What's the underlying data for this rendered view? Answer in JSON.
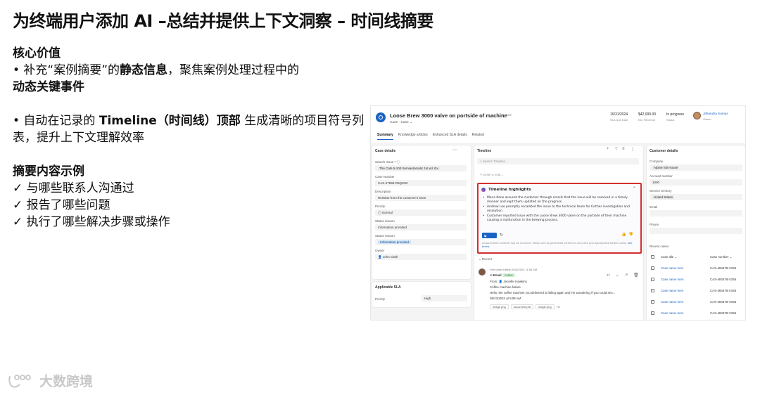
{
  "slide": {
    "title": "为终端用户添加 AI –总结并提供上下文洞察 – 时间线摘要",
    "value_heading": "核心价值",
    "value_line1_pre": "• 补充“案例摘要”的",
    "value_line1_bold": "静态信息",
    "value_line1_post": "，聚焦案例处理过程中的",
    "value_line2_bold": "动态关键事件",
    "auto_pre": "• 自动在记录的 ",
    "auto_bold": "Timeline（时间线）顶部",
    "auto_post": " 生成清晰的项目符号列表，提升上下文理解效率",
    "example_heading": "摘要内容示例",
    "examples": [
      "✓ 与哪些联系人沟通过",
      "✓ 报告了哪些问题",
      "✓ 执行了哪些解决步骤或操作"
    ],
    "watermark": "大数跨境"
  },
  "app": {
    "record_title": "Loose Brew 3000 valve on portside of machine",
    "record_saved": "- Saved",
    "record_sub": "Case · Case ⌄",
    "meta": [
      {
        "value": "10/31/2024",
        "label": "SLA Due Date"
      },
      {
        "value": "$42,000.00",
        "label": "Est. Revenue"
      },
      {
        "value": "In progress",
        "label": "Status"
      }
    ],
    "owner_name": "Jithendra Kumar",
    "owner_role": "Owner",
    "tabs": [
      "Summary",
      "Knowledge articles",
      "Enhanced SLA details",
      "Related"
    ],
    "case_details": {
      "title": "Case details",
      "fields": [
        {
          "label": "Search Issue * ⓘ",
          "value": "The Cafe 5-100 Semiautomatic 1st ed. Ex"
        },
        {
          "label": "Case Number",
          "value": "CAS-47999-R8Q3N3"
        },
        {
          "label": "Description",
          "value": "Residue from the customer's brew"
        },
        {
          "label": "Priority",
          "value": "◯ Normal"
        },
        {
          "label": "Status reason",
          "value": "Information provided"
        },
        {
          "label": "Status reason",
          "value": "Information provided"
        },
        {
          "label": "Owner",
          "value": "John Clark"
        }
      ]
    },
    "sla": {
      "title": "Applicable SLA",
      "priority_label": "Priority",
      "priority_value": "High"
    },
    "timeline": {
      "title": "Timeline",
      "search_placeholder": "Search Timeline",
      "note_placeholder": "Enter a note...",
      "highlights_title": "Timeline highlights",
      "bullets": [
        "Mona Kane assured the customer through emails that the issue will be resolved in a timely manner and kept them updated on the progress.",
        "Andrew Lee promptly escalated the issue to the technical team for further investigation and resolution.",
        "Customer reported issue with the Loose Brew 3000 valve on the portside of their machine causing a malfunction in the brewing process."
      ],
      "copy_label": "Copy",
      "ai_note": "AI-generated content may be incorrect. Make sure AI-generated content is accurate and appropriate before using.",
      "ai_note_link": "See terms",
      "recent_label": "Recent",
      "email": {
        "meta": "Sent (late edited) 9/16/2024 11:56 AM",
        "type": "Email",
        "status": "Active",
        "from_label": "From:",
        "from_name": "Jennifer Hawkins",
        "subject": "Coffee machine failure",
        "body": "Hello, the coffee machine you delivered is failing again and I'm wondering if you could sen...",
        "date": "08/23/2024 at 9:08 AM",
        "attachments": [
          "image.png",
          "document.pdf",
          "image.png",
          "+3"
        ]
      }
    },
    "customer_details": {
      "title": "Customer details",
      "company_label": "Company",
      "company_value": "Alpine Ski House",
      "account_label": "Account number",
      "account_value": "1000",
      "territory_label": "Service territory",
      "territory_value": "United States",
      "email_label": "Email",
      "phone_label": "Phone",
      "recent_cases_label": "Recent cases",
      "case_title_header": "Case title ⌄",
      "case_number_header": "Case number ⌄",
      "cases": [
        {
          "title": "Case name here",
          "number": "CAS-484578-V3S6"
        },
        {
          "title": "Case name here",
          "number": "CAS-484578-V3S6"
        },
        {
          "title": "Case name here",
          "number": "CAS-484578-V3S6"
        },
        {
          "title": "Case name here",
          "number": "CAS-484578-V3S6"
        },
        {
          "title": "Case name here",
          "number": "CAS-484578-V3S6"
        }
      ]
    }
  },
  "colors": {
    "accent": "#1b63c2",
    "highlight_border": "#d32f2f"
  }
}
